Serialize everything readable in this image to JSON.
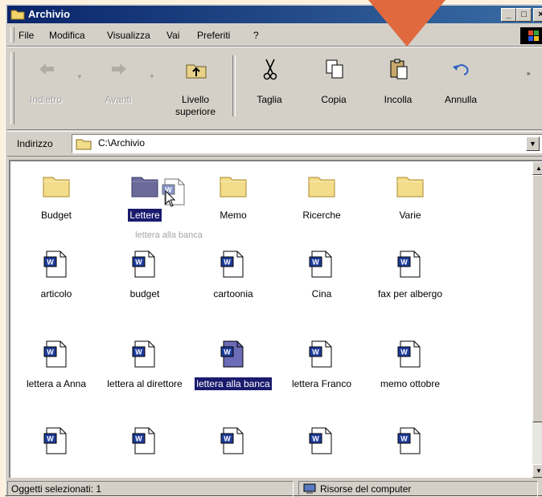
{
  "window": {
    "title": "Archivio",
    "controls": {
      "minimize": "_",
      "maximize": "□",
      "close": "×"
    }
  },
  "menu": [
    {
      "label": "File"
    },
    {
      "label": "Modifica"
    },
    {
      "label": "Visualizza"
    },
    {
      "label": "Vai"
    },
    {
      "label": "Preferiti"
    },
    {
      "label": "?"
    }
  ],
  "toolbar": {
    "buttons": [
      {
        "label": "Indietro",
        "icon": "back-arrow-icon",
        "disabled": true
      },
      {
        "label": "Avanti",
        "icon": "forward-arrow-icon",
        "disabled": true
      },
      {
        "label": "Livello superiore",
        "icon": "up-folder-icon",
        "disabled": false
      },
      {
        "label": "Taglia",
        "icon": "scissors-icon",
        "disabled": false
      },
      {
        "label": "Copia",
        "icon": "copy-icon",
        "disabled": false
      },
      {
        "label": "Incolla",
        "icon": "paste-icon",
        "disabled": false
      },
      {
        "label": "Annulla",
        "icon": "undo-icon",
        "disabled": false
      }
    ]
  },
  "address": {
    "label": "Indirizzo",
    "value": "C:\\Archivio"
  },
  "files": [
    {
      "name": "Budget",
      "type": "folder"
    },
    {
      "name": "Lettere",
      "type": "folder",
      "drop_target": true
    },
    {
      "name": "Memo",
      "type": "folder"
    },
    {
      "name": "Ricerche",
      "type": "folder"
    },
    {
      "name": "Varie",
      "type": "folder"
    },
    {
      "name": "articolo",
      "type": "document"
    },
    {
      "name": "budget",
      "type": "document"
    },
    {
      "name": "cartoonia",
      "type": "document"
    },
    {
      "name": "Cina",
      "type": "document"
    },
    {
      "name": "fax per albergo",
      "type": "document"
    },
    {
      "name": "lettera a Anna",
      "type": "document"
    },
    {
      "name": "lettera al direttore",
      "type": "document"
    },
    {
      "name": "lettera alla banca",
      "type": "document",
      "selected": true
    },
    {
      "name": "lettera Franco",
      "type": "document"
    },
    {
      "name": "memo ottobre",
      "type": "document"
    },
    {
      "name": "",
      "type": "document"
    },
    {
      "name": "",
      "type": "document"
    },
    {
      "name": "",
      "type": "document"
    },
    {
      "name": "",
      "type": "document"
    },
    {
      "name": "",
      "type": "document"
    }
  ],
  "drag_ghost_label": "lettera alla banca",
  "status": {
    "left": "Oggetti selezionati: 1",
    "right": "Risorse del computer"
  },
  "colors": {
    "highlight": "#1a1a6e",
    "callout_arrow": "#e06a3e",
    "folder": "#f3dc8a"
  }
}
